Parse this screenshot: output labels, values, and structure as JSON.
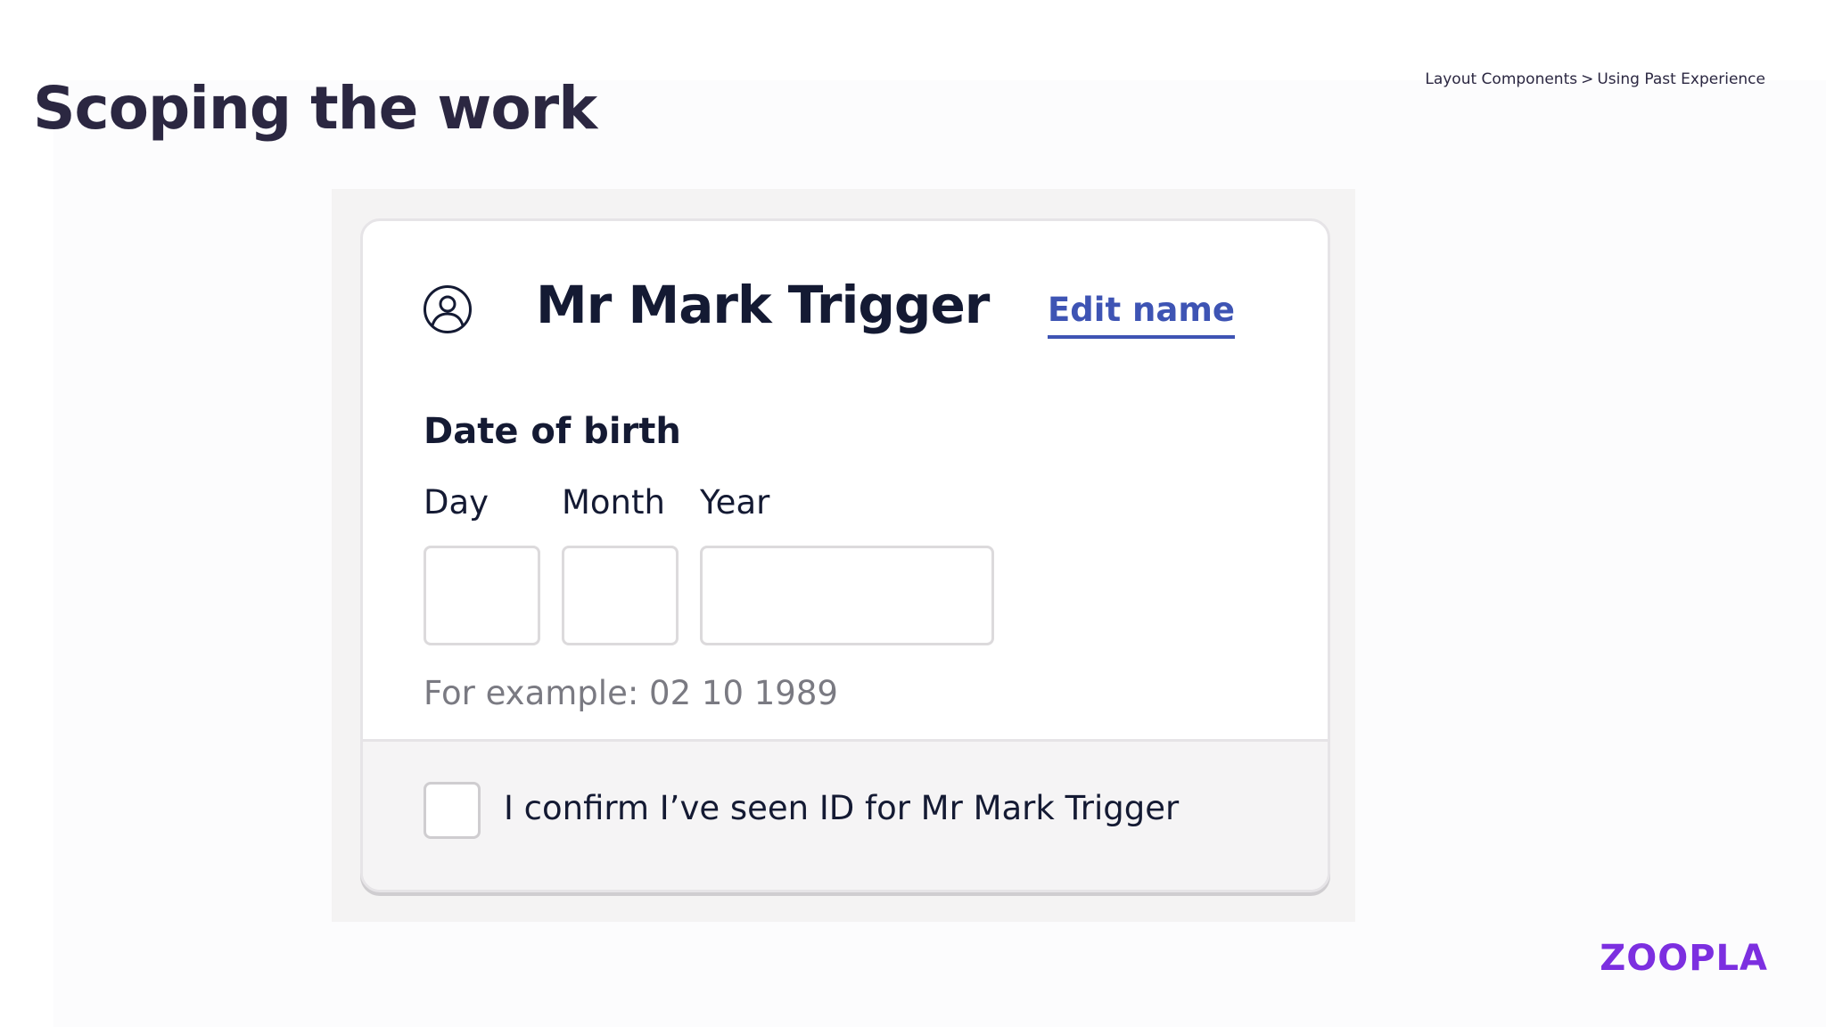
{
  "slide": {
    "title": "Scoping the work",
    "breadcrumb": {
      "section": "Layout Components",
      "separator": ">",
      "page": "Using Past Experience"
    },
    "logo": "ZOOPLA"
  },
  "card": {
    "avatar_icon": "user-circle-icon",
    "name": "Mr Mark Trigger",
    "edit_link": "Edit name",
    "dob": {
      "heading": "Date of birth",
      "day_label": "Day",
      "month_label": "Month",
      "year_label": "Year",
      "day_value": "",
      "month_value": "",
      "year_value": "",
      "hint": "For example: 02 10 1989"
    },
    "confirm": {
      "checked": false,
      "label": "I confirm I’ve seen ID for Mr Mark Trigger"
    }
  },
  "colors": {
    "title": "#2b2741",
    "link": "#3e54b4",
    "brand": "#7c2fe0",
    "text": "#141a33",
    "hint": "#7a7a82"
  }
}
